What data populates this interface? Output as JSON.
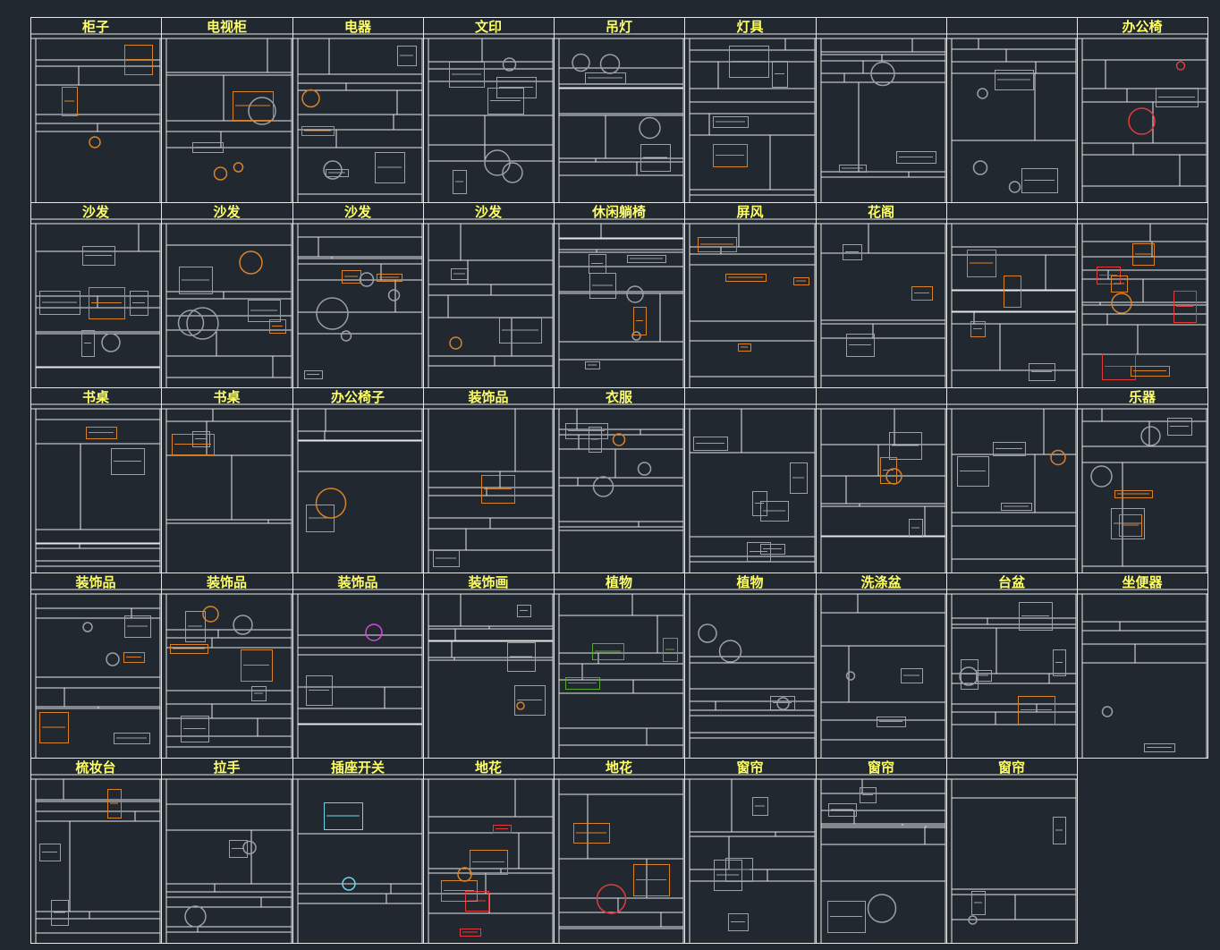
{
  "colors": {
    "background": "#212830",
    "grid_line": "#e6e6e6",
    "title_text": "#ffff66",
    "thumb_gray": "#9aa0a6",
    "thumb_orange": "#d9822b",
    "thumb_red": "#e23b3b",
    "thumb_green": "#56a832",
    "thumb_blue": "#3b5bd9",
    "thumb_cyan": "#6fd3ea",
    "thumb_magenta": "#d24bd8"
  },
  "catalog": {
    "rows": [
      {
        "cells": [
          "柜子",
          "电视柜",
          "电器",
          "文印",
          "吊灯",
          "灯具",
          "",
          "",
          "办公椅"
        ]
      },
      {
        "cells": [
          "沙发",
          "沙发",
          "沙发",
          "沙发",
          "休闲躺椅",
          "屏风",
          "花阁",
          "",
          ""
        ]
      },
      {
        "cells": [
          "书桌",
          "书桌",
          "办公椅子",
          "装饰品",
          "衣服",
          "",
          "",
          "",
          "乐器"
        ]
      },
      {
        "cells": [
          "装饰品",
          "装饰品",
          "装饰品",
          "装饰画",
          "植物",
          "植物",
          "洗涤盆",
          "台盆",
          "坐便器"
        ]
      },
      {
        "cells": [
          "梳妆台",
          "拉手",
          "插座开关",
          "地花",
          "地花",
          "窗帘",
          "窗帘",
          "窗帘"
        ]
      }
    ]
  }
}
